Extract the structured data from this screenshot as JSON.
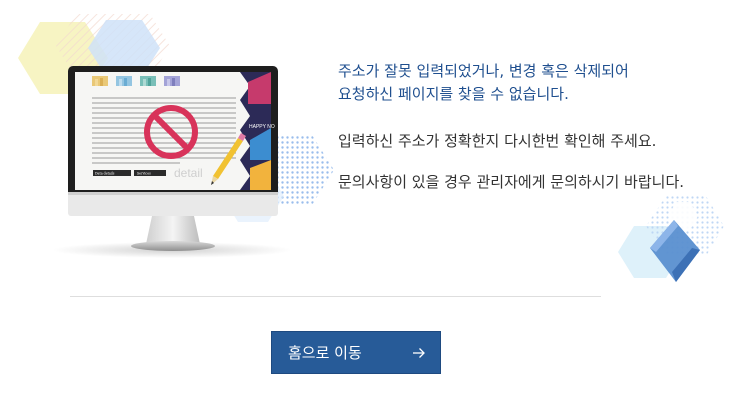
{
  "error_message": {
    "primary_line1": "주소가 잘못 입력되었거나, 변경 혹은 삭제되어",
    "primary_line2": "요청하신 페이지를 찾을 수 없습니다.",
    "secondary": "입력하신 주소가 정확한지 다시한번 확인해 주세요.",
    "contact": "문의사항이 있을 경우 관리자에게 문의하시기 바랍니다."
  },
  "home_button": {
    "label": "홈으로 이동",
    "icon": "arrow-right-icon"
  },
  "illustration": {
    "icons": [
      "monitor-icon",
      "no-entry-icon",
      "pencil-icon"
    ],
    "screen_labels": {
      "left_tab": "Data details",
      "right_tab": "Services",
      "watermark": "detail",
      "banner": "HAPPY NO"
    }
  },
  "colors": {
    "primary_text": "#1f4f8f",
    "body_text": "#333333",
    "button_bg": "#275b98",
    "no_entry_red": "#d8335a"
  }
}
